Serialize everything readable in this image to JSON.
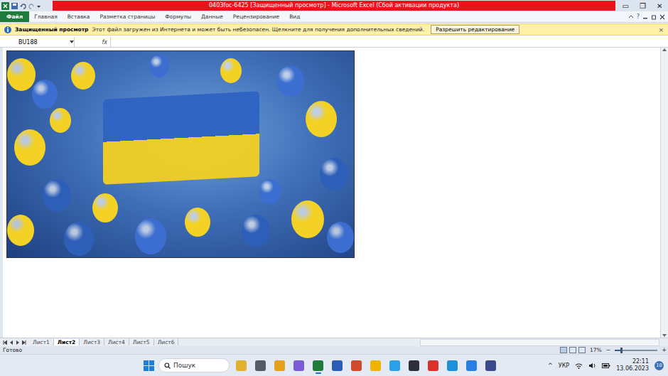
{
  "window": {
    "title": "0403foc-6425  [Защищенный просмотр]  -  Microsoft Excel (Сбой активации продукта)",
    "controls": [
      "▭",
      "❐",
      "✕"
    ]
  },
  "ribbon": {
    "tabs": [
      {
        "label": "Файл",
        "selected": true
      },
      {
        "label": "Главная",
        "selected": false
      },
      {
        "label": "Вставка",
        "selected": false
      },
      {
        "label": "Разметка страницы",
        "selected": false
      },
      {
        "label": "Формулы",
        "selected": false
      },
      {
        "label": "Данные",
        "selected": false
      },
      {
        "label": "Рецензирование",
        "selected": false
      },
      {
        "label": "Вид",
        "selected": false
      }
    ],
    "help": "?"
  },
  "protected_bar": {
    "title": "Защищенный просмотр",
    "message": "Этот файл загружен из Интернета и может быть небезопасен. Щелкните для получения дополнительных сведений.",
    "button": "Разрешить редактирование",
    "close": "×"
  },
  "formula_bar": {
    "name_box": "BU188",
    "fx": "fx"
  },
  "sheet_tabs": [
    {
      "label": "Лист1",
      "selected": false
    },
    {
      "label": "Лист2",
      "selected": true
    },
    {
      "label": "Лист3",
      "selected": false
    },
    {
      "label": "Лист4",
      "selected": false
    },
    {
      "label": "Лист5",
      "selected": false
    },
    {
      "label": "Лист6",
      "selected": false
    }
  ],
  "status_bar": {
    "text": "Готово",
    "zoom": "17%",
    "zoom_level": 0.15,
    "minus": "−",
    "plus": "+"
  },
  "taskbar": {
    "search_placeholder": "Пошук",
    "language": "УКР",
    "time": "22:11",
    "date": "13.06.2023",
    "badge": "10",
    "chevron": "^",
    "apps": [
      {
        "active": false
      },
      {
        "active": false
      },
      {
        "active": false
      },
      {
        "active": false
      },
      {
        "active": true
      },
      {
        "active": false
      },
      {
        "active": false
      },
      {
        "active": false
      },
      {
        "active": false
      },
      {
        "active": false
      },
      {
        "active": false
      },
      {
        "active": false
      },
      {
        "active": false
      },
      {
        "active": false
      }
    ]
  }
}
